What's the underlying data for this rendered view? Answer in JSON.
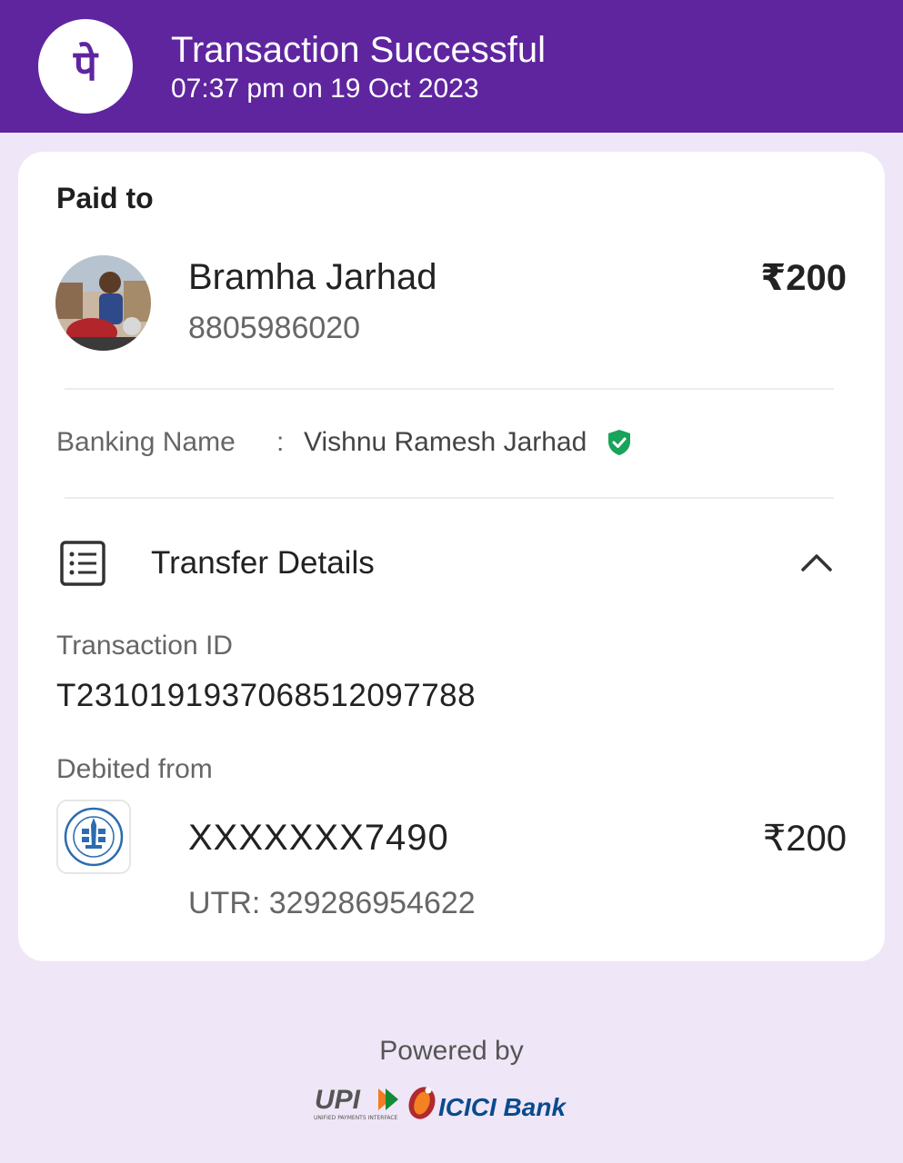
{
  "header": {
    "title": "Transaction Successful",
    "datetime": "07:37 pm on 19 Oct 2023",
    "logo_icon": "phonepe-logo-icon",
    "logo_glyph": "पे",
    "bg_color": "#5f259f"
  },
  "paid_to": {
    "label": "Paid to",
    "name": "Bramha Jarhad",
    "phone": "8805986020",
    "amount": "₹200",
    "avatar_icon": "avatar"
  },
  "banking": {
    "label": "Banking Name",
    "separator": ":",
    "value": "Vishnu Ramesh Jarhad",
    "verified_icon": "verified-shield-icon",
    "verified_color": "#1aa35a"
  },
  "transfer_details": {
    "title": "Transfer Details",
    "icon": "receipt-list-icon",
    "toggle_icon": "chevron-up-icon",
    "transaction_id_label": "Transaction ID",
    "transaction_id": "T2310191937068512097788",
    "debited_from_label": "Debited from",
    "account": "XXXXXXX7490",
    "account_amount": "₹200",
    "utr": "UTR: 329286954622",
    "bank_icon": "bank-of-maharashtra-logo-icon"
  },
  "footer": {
    "powered_by": "Powered by",
    "upi_logo_text": "UPI",
    "upi_tagline": "UNIFIED PAYMENTS INTERFACE",
    "bank_logo_text": "ICICI Bank"
  }
}
